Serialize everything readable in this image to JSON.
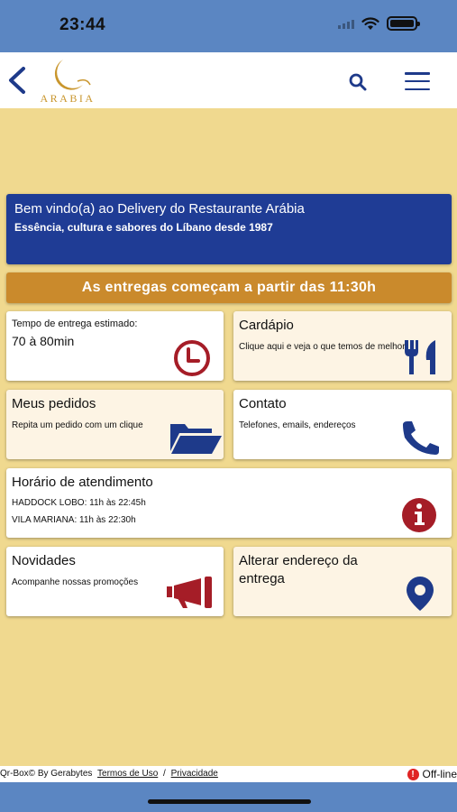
{
  "status_bar": {
    "time": "23:44"
  },
  "header": {
    "logo_text": "ARABIA",
    "back_icon": "chevron-left-icon",
    "search_icon": "search-icon",
    "menu_icon": "hamburger-menu-icon"
  },
  "welcome": {
    "title": "Bem vindo(a) ao Delivery do Restaurante Arábia",
    "subtitle": "Essência, cultura e sabores do Líbano desde 1987"
  },
  "banner": {
    "text": "As entregas começam a partir das 11:30h"
  },
  "cards": {
    "delivery_time": {
      "label": "Tempo de entrega estimado:",
      "value": "70 à 80min",
      "icon": "clock-icon"
    },
    "menu": {
      "title": "Cardápio",
      "text": "Clique aqui e veja o que temos de melhor",
      "icon": "fork-knife-icon"
    },
    "orders": {
      "title": "Meus pedidos",
      "text": "Repita um pedido com um clique",
      "icon": "folder-open-icon"
    },
    "contact": {
      "title": "Contato",
      "text": "Telefones, emails, endereços",
      "icon": "phone-icon"
    },
    "hours": {
      "title": "Horário de atendimento",
      "line1": "HADDOCK LOBO: 11h às 22:45h",
      "line2": "VILA MARIANA: 11h às 22:30h",
      "icon": "info-icon"
    },
    "news": {
      "title": "Novidades",
      "text": "Acompanhe nossas promoções",
      "icon": "megaphone-icon"
    },
    "address": {
      "title": "Alterar endereço da entrega",
      "icon": "map-marker-icon"
    }
  },
  "footer": {
    "brand": "Qr-Box© By Gerabytes",
    "terms": "Termos de Uso",
    "separator": "/",
    "privacy": "Privacidade",
    "status": "Off-line",
    "status_icon": "!"
  },
  "colors": {
    "primary_blue": "#1f3c95",
    "banner_orange": "#ca8a2c",
    "background": "#f0d98f",
    "icon_red": "#a51d27",
    "icon_blue": "#1e3a8a"
  }
}
